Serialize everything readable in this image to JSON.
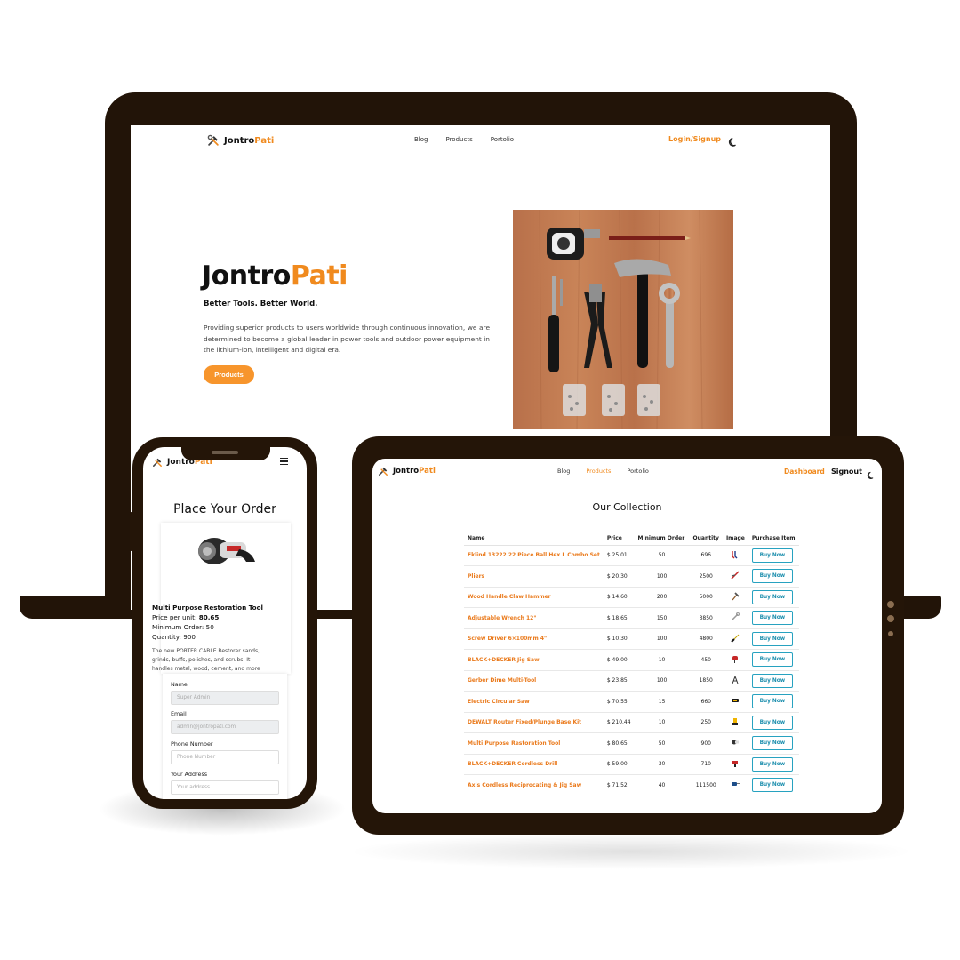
{
  "brand": {
    "prefix": "Jontro",
    "suffix": "Pati"
  },
  "colors": {
    "accent": "#f08a1e",
    "device_frame": "#221408",
    "buy_button": "#27a2c0"
  },
  "laptop": {
    "nav": {
      "links": [
        "Blog",
        "Products",
        "Portolio"
      ],
      "login": "Login/Signup",
      "theme_icon": "moon-icon"
    },
    "hero": {
      "title_prefix": "Jontro",
      "title_suffix": "Pati",
      "tagline": "Better Tools. Better World.",
      "description": "Providing superior products to users worldwide through continuous innovation, we are determined to become a global leader in power tools and outdoor power equipment in the lithium-ion, intelligent and digital era.",
      "button": "Products"
    }
  },
  "phone": {
    "title": "Place Your Order",
    "product": {
      "name": "Multi Purpose Restoration Tool",
      "price_label": "Price per unit:",
      "price": "80.65",
      "min_order_label": "Minimum Order:",
      "min_order": "50",
      "quantity_label": "Quantity:",
      "quantity": "900",
      "description": "The new PORTER CABLE Restorer sands, grinds, buffs, polishes, and scrubs. It handles metal, wood, cement, and more"
    },
    "form": {
      "name_label": "Name",
      "name_value": "Super Admin",
      "email_label": "Email",
      "email_value": "admin@jontropati.com",
      "phone_label": "Phone Number",
      "phone_placeholder": "Phone Number",
      "address_label": "Your Address",
      "address_placeholder": "Your address"
    }
  },
  "tablet": {
    "nav": {
      "links": [
        "Blog",
        "Products",
        "Portolio"
      ],
      "dashboard": "Dashboard",
      "signout": "Signout"
    },
    "title": "Our Collection",
    "columns": [
      "Name",
      "Price",
      "Minimum Order",
      "Quantity",
      "Image",
      "Purchase Item"
    ],
    "buy_label": "Buy Now",
    "rows": [
      {
        "name": "Eklind 13222 22 Piece Ball Hex L Combo Set",
        "price": "$ 25.01",
        "min": "50",
        "qty": "696",
        "icon": "hex-key-icon"
      },
      {
        "name": "Pliers",
        "price": "$ 20.30",
        "min": "100",
        "qty": "2500",
        "icon": "pliers-icon"
      },
      {
        "name": "Wood Handle Claw Hammer",
        "price": "$ 14.60",
        "min": "200",
        "qty": "5000",
        "icon": "hammer-icon"
      },
      {
        "name": "Adjustable Wrench 12\"",
        "price": "$ 18.65",
        "min": "150",
        "qty": "3850",
        "icon": "wrench-icon"
      },
      {
        "name": "Screw Driver 6×100mm 4\"",
        "price": "$ 10.30",
        "min": "100",
        "qty": "4800",
        "icon": "screwdriver-icon"
      },
      {
        "name": "BLACK+DECKER Jig Saw",
        "price": "$ 49.00",
        "min": "10",
        "qty": "450",
        "icon": "jigsaw-icon"
      },
      {
        "name": "Gerber Dime Multi-Tool",
        "price": "$ 23.85",
        "min": "100",
        "qty": "1850",
        "icon": "multitool-icon"
      },
      {
        "name": "Electric Circular Saw",
        "price": "$ 70.55",
        "min": "15",
        "qty": "660",
        "icon": "circular-saw-icon"
      },
      {
        "name": "DEWALT Router Fixed/Plunge Base Kit",
        "price": "$ 210.44",
        "min": "10",
        "qty": "250",
        "icon": "router-icon"
      },
      {
        "name": "Multi Purpose Restoration Tool",
        "price": "$ 80.65",
        "min": "50",
        "qty": "900",
        "icon": "restoration-tool-icon"
      },
      {
        "name": "BLACK+DECKER Cordless Drill",
        "price": "$ 59.00",
        "min": "30",
        "qty": "710",
        "icon": "drill-icon"
      },
      {
        "name": "Axis Cordless Reciprocating & Jig Saw",
        "price": "$ 71.52",
        "min": "40",
        "qty": "111500",
        "icon": "reciprocating-saw-icon"
      }
    ]
  }
}
